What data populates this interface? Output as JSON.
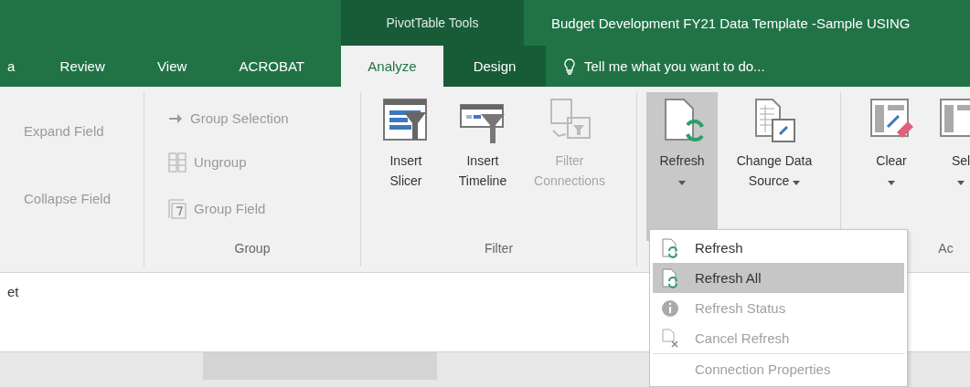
{
  "title_bar": {
    "context_label": "PivotTable Tools",
    "title": "Budget Development FY21 Data Template -Sample USING"
  },
  "tabs": [
    {
      "label": "a",
      "selected": false,
      "contextual": false
    },
    {
      "label": "Review",
      "selected": false,
      "contextual": false
    },
    {
      "label": "View",
      "selected": false,
      "contextual": false
    },
    {
      "label": "ACROBAT",
      "selected": false,
      "contextual": false
    },
    {
      "label": "Analyze",
      "selected": true,
      "contextual": true
    },
    {
      "label": "Design",
      "selected": false,
      "contextual": true
    }
  ],
  "tell_me": {
    "placeholder": "Tell me what you want to do..."
  },
  "ribbon_groups": [
    {
      "kind": "list",
      "items": [
        {
          "label": "Expand Field",
          "disabled": true
        },
        {
          "label": "Collapse Field",
          "disabled": true
        }
      ]
    },
    {
      "kind": "list",
      "label": "Group",
      "items": [
        {
          "label": "Group Selection",
          "disabled": true
        },
        {
          "label": "Ungroup",
          "disabled": true
        },
        {
          "label": "Group Field",
          "disabled": true
        }
      ]
    },
    {
      "kind": "large",
      "label": "Filter",
      "items": [
        {
          "label": "Insert Slicer",
          "disabled": false,
          "pressed": false
        },
        {
          "label": "Insert Timeline",
          "disabled": false,
          "pressed": false
        },
        {
          "label": "Filter Connections",
          "disabled": true,
          "pressed": false
        }
      ]
    },
    {
      "kind": "large",
      "items": [
        {
          "label": "Refresh",
          "disabled": false,
          "pressed": true,
          "dropdown": true
        },
        {
          "label": "Change Data Source",
          "disabled": false,
          "pressed": false,
          "dropdown": true
        }
      ]
    },
    {
      "kind": "large",
      "label": "Ac",
      "items": [
        {
          "label": "Clear",
          "disabled": false,
          "pressed": false,
          "dropdown": true
        },
        {
          "label": "Sel",
          "disabled": false,
          "pressed": false,
          "dropdown": true
        }
      ]
    }
  ],
  "formula_area": {
    "text": "et"
  },
  "refresh_menu": [
    {
      "label": "Refresh",
      "selected": false,
      "disabled": false
    },
    {
      "label": "Refresh All",
      "selected": true,
      "disabled": false
    },
    {
      "label": "Refresh Status",
      "selected": false,
      "disabled": true
    },
    {
      "label": "Cancel Refresh",
      "selected": false,
      "disabled": true
    },
    {
      "label": "Connection Properties",
      "selected": false,
      "disabled": true
    }
  ]
}
